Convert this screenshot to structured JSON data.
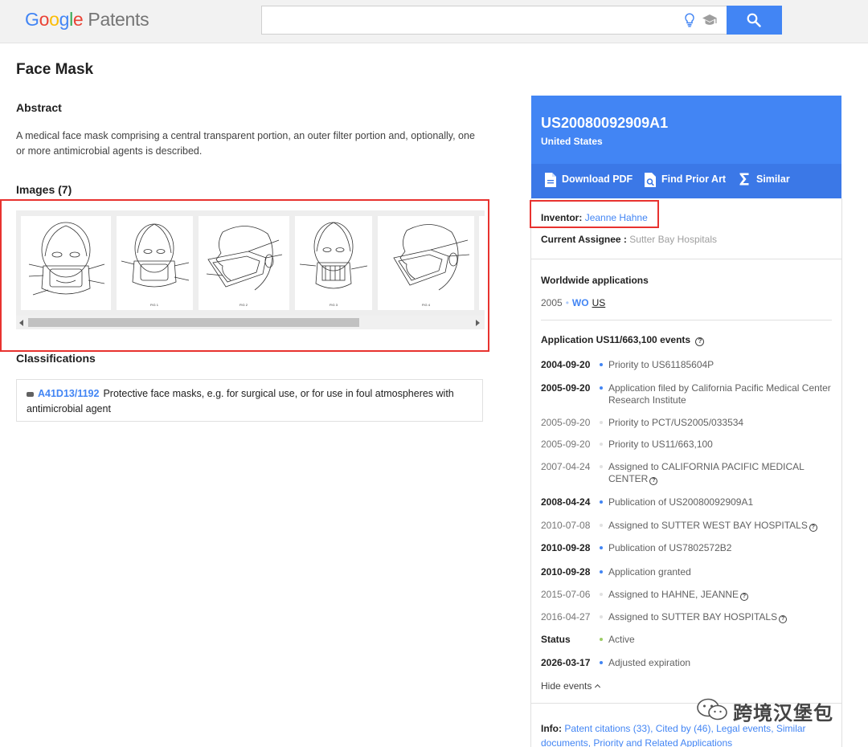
{
  "header": {
    "logo_google": [
      "G",
      "o",
      "o",
      "g",
      "l",
      "e"
    ],
    "logo_patents": "Patents",
    "search_value": "",
    "icons": [
      "lightbulb-icon",
      "school-icon",
      "search-icon"
    ]
  },
  "main": {
    "title": "Face Mask",
    "abstract_heading": "Abstract",
    "abstract_text": "A medical face mask comprising a central transparent portion, an outer filter portion and, optionally, one or more antimicrobial agents is described.",
    "images_heading": "Images (7)",
    "thumb_labels": [
      "",
      "FIG 1",
      "FIG 2",
      "FIG 3",
      "FIG 4"
    ],
    "classifications_heading": "Classifications",
    "classification": {
      "code": "A41D13/1192",
      "description": "Protective face masks, e.g. for surgical use, or for use in foul atmospheres with antimicrobial agent"
    }
  },
  "panel": {
    "pub_number": "US20080092909A1",
    "country": "United States",
    "actions": {
      "download_pdf": "Download PDF",
      "find_prior_art": "Find Prior Art",
      "similar": "Similar"
    },
    "inventor_label": "Inventor:",
    "inventor_name": "Jeanne Hahne",
    "assignee_label": "Current Assignee :",
    "assignee_name": "Sutter Bay Hospitals",
    "worldwide_title": "Worldwide applications",
    "worldwide_year": "2005",
    "worldwide_dot": "•",
    "worldwide_wo": "WO",
    "worldwide_us": "US",
    "events_title": "Application US11/663,100 events",
    "events": [
      {
        "date": "2004-09-20",
        "text": "Priority to US61185604P",
        "bold": true,
        "dot": "#4285f4",
        "help": false
      },
      {
        "date": "2005-09-20",
        "text": "Application filed by California Pacific Medical Center Research Institute",
        "bold": true,
        "dot": "#4285f4",
        "help": false
      },
      {
        "date": "2005-09-20",
        "text": "Priority to PCT/US2005/033534",
        "bold": false,
        "dot": "#e0e0e0",
        "help": false
      },
      {
        "date": "2005-09-20",
        "text": "Priority to US11/663,100",
        "bold": false,
        "dot": "#e0e0e0",
        "help": false
      },
      {
        "date": "2007-04-24",
        "text": "Assigned to CALIFORNIA PACIFIC MEDICAL CENTER",
        "bold": false,
        "dot": "#e0e0e0",
        "help": true
      },
      {
        "date": "2008-04-24",
        "text": "Publication of US20080092909A1",
        "bold": true,
        "dot": "#4285f4",
        "help": false
      },
      {
        "date": "2010-07-08",
        "text": "Assigned to SUTTER WEST BAY HOSPITALS",
        "bold": false,
        "dot": "#e0e0e0",
        "help": true
      },
      {
        "date": "2010-09-28",
        "text": "Publication of US7802572B2",
        "bold": true,
        "dot": "#4285f4",
        "help": false
      },
      {
        "date": "2010-09-28",
        "text": "Application granted",
        "bold": true,
        "dot": "#4285f4",
        "help": false
      },
      {
        "date": "2015-07-06",
        "text": "Assigned to HAHNE, JEANNE",
        "bold": false,
        "dot": "#e0e0e0",
        "help": true
      },
      {
        "date": "2016-04-27",
        "text": "Assigned to SUTTER BAY HOSPITALS",
        "bold": false,
        "dot": "#e0e0e0",
        "help": true
      },
      {
        "date": "Status",
        "text": "Active",
        "bold": true,
        "dot": "#9ccc65",
        "help": false
      },
      {
        "date": "2026-03-17",
        "text": "Adjusted expiration",
        "bold": true,
        "dot": "#4285f4",
        "help": false
      }
    ],
    "hide_events": "Hide events",
    "info_label": "Info:",
    "info_links": [
      "Patent citations (33)",
      "Cited by (46)",
      "Legal events",
      "Similar documents",
      "Priority and Related Applications"
    ]
  },
  "watermark": {
    "text": "跨境汉堡包"
  }
}
